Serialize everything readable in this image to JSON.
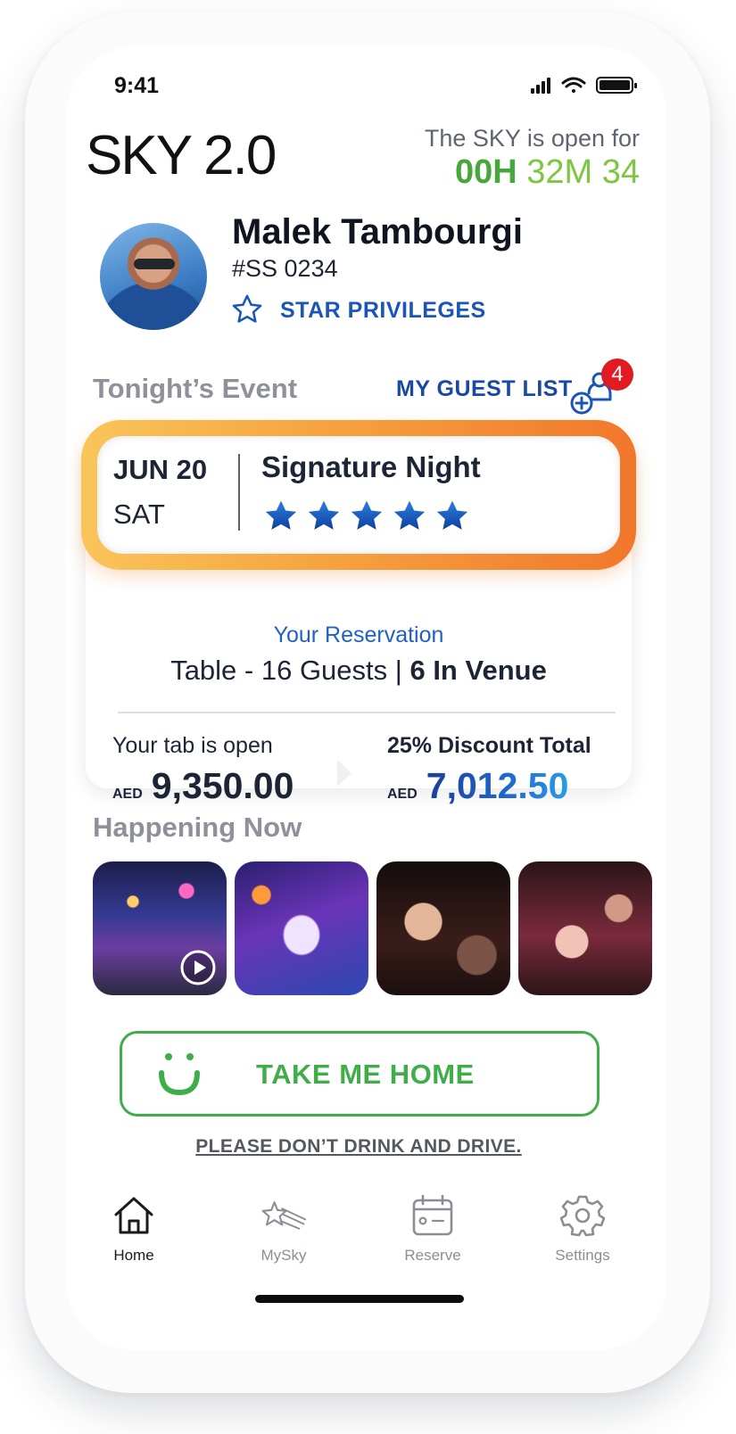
{
  "status_bar": {
    "time": "9:41",
    "icons": [
      "signal-icon",
      "wifi-icon",
      "battery-icon"
    ]
  },
  "header": {
    "logo": "SKY 2.0",
    "open_label": "The SKY is open for",
    "countdown": {
      "hours": "00H",
      "minutes": "32M",
      "seconds": "34"
    }
  },
  "profile": {
    "name": "Malek Tambourgi",
    "member_id": "#SS 0234",
    "privilege": "STAR PRIVILEGES"
  },
  "tonight": {
    "title": "Tonight’s Event",
    "guest_list_label": "MY GUEST LIST",
    "guest_count_badge": "4",
    "event": {
      "date": "JUN 20",
      "day": "SAT",
      "name": "Signature Night",
      "rating": 5
    },
    "reservation": {
      "label": "Your Reservation",
      "detail_prefix": "Table - 16 Guests",
      "detail_separator": "|",
      "detail_venue": "6 In Venue"
    },
    "tab": {
      "label": "Your tab is open",
      "currency": "AED",
      "amount": "9,350.00"
    },
    "discount": {
      "label": "25% Discount Total",
      "currency": "AED",
      "amount": "7,012.50"
    }
  },
  "happening": {
    "title": "Happening Now",
    "items": [
      {
        "name": "rooftop-party",
        "has_video": true
      },
      {
        "name": "stage-crowd",
        "has_video": false
      },
      {
        "name": "guests-portrait",
        "has_video": false
      },
      {
        "name": "dance-floor",
        "has_video": false
      }
    ]
  },
  "take_home": {
    "label": "TAKE ME HOME",
    "note": "PLEASE DON’T DRINK AND DRIVE."
  },
  "nav": {
    "items": [
      {
        "label": "Home",
        "icon": "home-icon",
        "active": true
      },
      {
        "label": "MySky",
        "icon": "shooting-star-icon",
        "active": false
      },
      {
        "label": "Reserve",
        "icon": "calendar-icon",
        "active": false
      },
      {
        "label": "Settings",
        "icon": "gear-icon",
        "active": false
      }
    ]
  },
  "colors": {
    "accent_blue": "#1a56b8",
    "countdown_green": "#46a83a",
    "home_green": "#3fae49",
    "event_frame_orange": "#f1772b",
    "badge_red": "#e01b22"
  }
}
